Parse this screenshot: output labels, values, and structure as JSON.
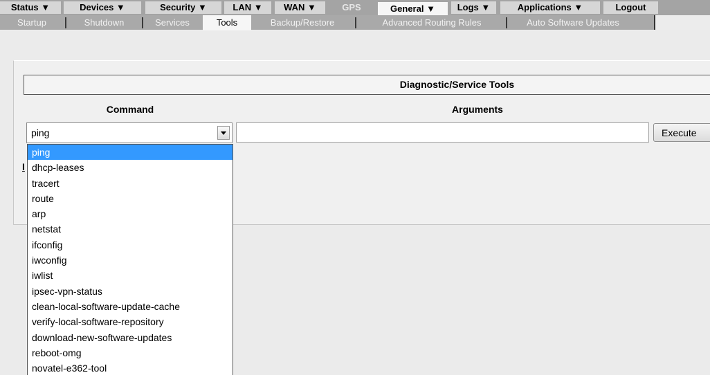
{
  "nav": {
    "top_items": [
      {
        "label": "Status ▼"
      },
      {
        "label": "Devices ▼"
      },
      {
        "label": "Security ▼"
      },
      {
        "label": "LAN ▼"
      },
      {
        "label": "WAN ▼"
      },
      {
        "label": "GPS"
      },
      {
        "label": "General ▼"
      },
      {
        "label": "Logs ▼"
      },
      {
        "label": "Applications ▼"
      },
      {
        "label": "Logout"
      }
    ],
    "sub_items": [
      {
        "label": "Startup"
      },
      {
        "label": "Shutdown"
      },
      {
        "label": "Services"
      },
      {
        "label": "Tools"
      },
      {
        "label": "Backup/Restore"
      },
      {
        "label": "Advanced Routing Rules"
      },
      {
        "label": "Auto Software Updates"
      }
    ]
  },
  "panel": {
    "title": "Diagnostic/Service Tools",
    "command_header": "Command",
    "arguments_header": "Arguments",
    "selected_command": "ping",
    "arguments_value": "",
    "execute_label": "Execute",
    "hidden_fragment": "I"
  },
  "dropdown": {
    "options": [
      "ping",
      "dhcp-leases",
      "tracert",
      "route",
      "arp",
      "netstat",
      "ifconfig",
      "iwconfig",
      "iwlist",
      "ipsec-vpn-status",
      "clean-local-software-update-cache",
      "verify-local-software-repository",
      "download-new-software-updates",
      "reboot-omg",
      "novatel-e362-tool"
    ],
    "highlighted": "ping"
  },
  "colors": {
    "nav_bar": "#a4a4a4",
    "nav_item": "#d6d6d6",
    "highlight": "#3399ff",
    "page_bg": "#ebebeb"
  }
}
